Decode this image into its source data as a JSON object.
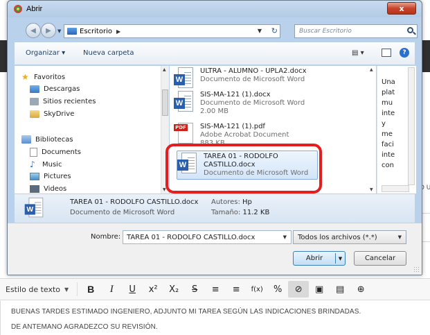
{
  "dialog": {
    "title": "Abrir",
    "close_label": "x"
  },
  "address": {
    "path": "Escritorio",
    "search_placeholder": "Buscar Escritorio"
  },
  "commands": {
    "organize": "Organizar ▾",
    "new_folder": "Nueva carpeta"
  },
  "navigation": {
    "items": [
      {
        "label": "Favoritos",
        "icon": "star-icon"
      },
      {
        "label": "Descargas",
        "icon": "downloads-folder-icon"
      },
      {
        "label": "Sitios recientes",
        "icon": "recent-places-icon"
      },
      {
        "label": "SkyDrive",
        "icon": "folder-icon"
      },
      {
        "label": "Bibliotecas",
        "icon": "libraries-icon"
      },
      {
        "label": "Documents",
        "icon": "document-icon"
      },
      {
        "label": "Music",
        "icon": "music-icon"
      },
      {
        "label": "Pictures",
        "icon": "pictures-icon"
      },
      {
        "label": "Videos",
        "icon": "video-icon"
      }
    ]
  },
  "files": [
    {
      "name": "ULTRA - ALUMNO - UPLA2.docx",
      "type": "Documento de Microsoft Word",
      "size": "",
      "icon": "word-icon"
    },
    {
      "name": "SIS-MA-121 (1).docx",
      "type": "Documento de Microsoft Word",
      "size": "2.00 MB",
      "icon": "word-icon"
    },
    {
      "name": "SIS-MA-121 (1).pdf",
      "type": "Adobe Acrobat Document",
      "size": "883 KB",
      "icon": "pdf-icon"
    },
    {
      "name_line1": "TAREA 01 - RODOLFO",
      "name_line2": "CASTILLO.docx",
      "type": "Documento de Microsoft Word",
      "icon": "word-icon",
      "selected": true
    }
  ],
  "preview_text": [
    "Una",
    "plat",
    "mu",
    "inte",
    "y",
    "me",
    "faci",
    "inte",
    "con"
  ],
  "details": {
    "name": "TAREA 01 - RODOLFO CASTILLO.docx",
    "kind": "Documento de Microsoft Word",
    "authors_label": "Autores:",
    "authors_value": "Hp",
    "size_label": "Tamaño:",
    "size_value": "11.2 KB"
  },
  "bottom": {
    "name_label": "Nombre:",
    "name_value": "TAREA 01 - RODOLFO CASTILLO.docx",
    "type_value": "Todos los archivos (*.*)",
    "open_label": "Abrir",
    "cancel_label": "Cancelar"
  },
  "editor": {
    "style_label": "Estilo de texto",
    "buttons": {
      "bold": "B",
      "italic": "I",
      "underline": "U",
      "superscript": "x²",
      "subscript": "X₂",
      "strike": "S",
      "ordered": "≡",
      "unordered": "≡",
      "formula": "f(x)",
      "link": "%",
      "attach": "⊘",
      "image": "▣",
      "media": "▤",
      "more": "⊕"
    },
    "line1": "BUENAS TARDES ESTIMADO INGENIERO, ADJUNTO MI TAREA SEGÚN LAS INDICACIONES BRINDADAS.",
    "line2": "DE ANTEMANO AGRADEZCO SU REVISIÓN."
  },
  "background": {
    "right_text": "D U"
  },
  "colors": {
    "highlight": "#e41e1e",
    "dialog_frame": "#b9d1ea",
    "word_blue": "#2a5fae"
  }
}
